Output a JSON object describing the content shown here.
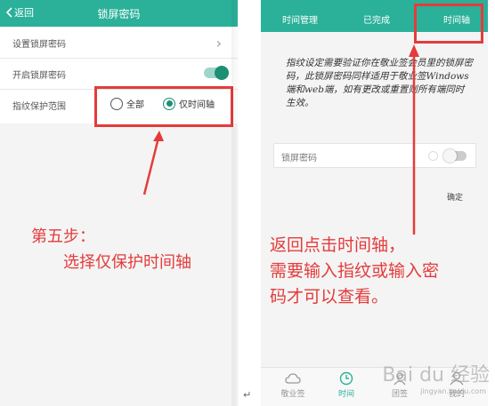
{
  "left": {
    "topbar": {
      "back_label": "返回",
      "title": "锁屏密码"
    },
    "rows": [
      {
        "label": "设置锁屏密码"
      },
      {
        "label": "开启锁屏密码"
      },
      {
        "label": "指纹保护范围"
      }
    ],
    "radio_options": [
      {
        "label": "全部",
        "selected": false
      },
      {
        "label": "仅时间轴",
        "selected": true
      }
    ],
    "annotation": {
      "line1": "第五步：",
      "line2": "选择仅保护时间轴"
    }
  },
  "right": {
    "tabs": [
      {
        "label": "时间管理"
      },
      {
        "label": "已完成"
      },
      {
        "label": "时间轴"
      }
    ],
    "note": "指纹设定需要验证你在敬业签会员里的锁屏密码，此锁屏密码同样适用于敬业签Windows端和web端，如有更改或重置则所有端同时生效。",
    "lock_row_label": "锁屏密码",
    "confirm_label": "确定",
    "bottom_nav": [
      {
        "label": "敬业签"
      },
      {
        "label": "时间"
      },
      {
        "label": "团签"
      },
      {
        "label": "我的"
      }
    ],
    "annotation": {
      "line1": "返回点击时间轴，",
      "line2": "需要输入指纹或输入密",
      "line3": "码才可以查看。"
    }
  },
  "watermark": {
    "brand": "Bai du 经验",
    "site": "jingyan.baidu.com"
  },
  "paragraph_mark": "↵",
  "colors": {
    "accent": "#2bb09a",
    "annotation_red": "#e53b3b",
    "toggle_on": "#1d8f73"
  }
}
